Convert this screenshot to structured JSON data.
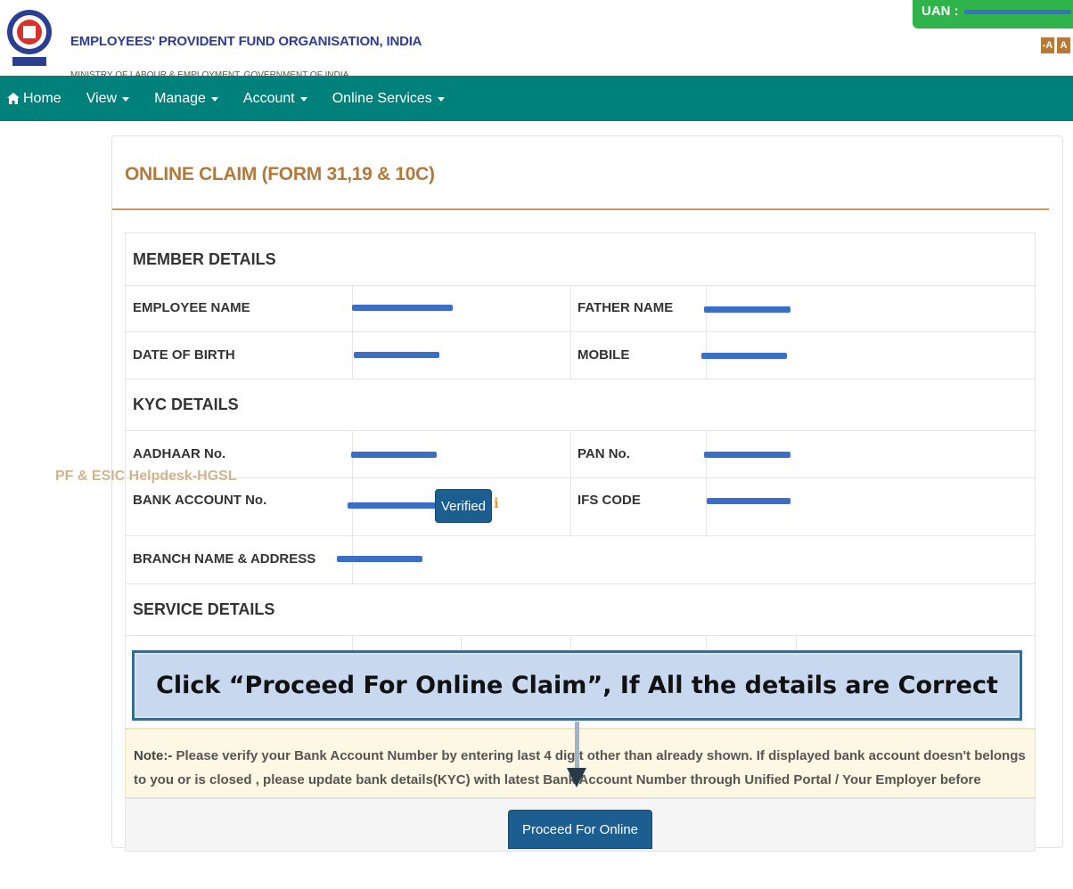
{
  "header": {
    "org_title": "EMPLOYEES' PROVIDENT FUND ORGANISATION, INDIA",
    "ministry": "MINISTRY OF LABOUR & EMPLOYMENT, GOVERNMENT OF INDIA",
    "uan_label": "UAN :",
    "font_decrease": "-A",
    "font_normal": "A"
  },
  "nav": {
    "home": "Home",
    "view": "View",
    "manage": "Manage",
    "account": "Account",
    "online_services": "Online Services"
  },
  "page": {
    "title": "ONLINE CLAIM (FORM 31,19 & 10C)"
  },
  "member_details": {
    "heading": "MEMBER DETAILS",
    "employee_name_label": "EMPLOYEE NAME",
    "father_name_label": "FATHER NAME",
    "dob_label": "DATE OF BIRTH",
    "mobile_label": "MOBILE"
  },
  "kyc_details": {
    "heading": "KYC DETAILS",
    "aadhaar_label": "AADHAAR No.",
    "pan_label": "PAN No.",
    "bank_account_label": "BANK ACCOUNT No.",
    "ifs_label": "IFS CODE",
    "verified_label": "Verified",
    "info_glyph": "i",
    "branch_label": "BRANCH NAME & ADDRESS"
  },
  "service_details": {
    "heading": "SERVICE DETAILS"
  },
  "watermark": "PF & ESIC Helpdesk-HGSL",
  "callout": "Click “Proceed For Online Claim”, If All the details are Correct",
  "note": {
    "prefix": "Note:-",
    "text": " Please verify your Bank Account Number by entering last 4 digit other than already shown. If displayed bank account doesn't belongs to you or is closed , please update bank details(KYC) with latest Bank Account Number through Unified Portal / Your Employer before proceeding with Online claim."
  },
  "proceed_button": "Proceed For Online Claim",
  "colors": {
    "nav_bg": "#00807a",
    "title": "#b2793b",
    "button": "#1b5e8f",
    "uan_bg": "#2fb34a",
    "redaction": "#3b6fc7"
  }
}
